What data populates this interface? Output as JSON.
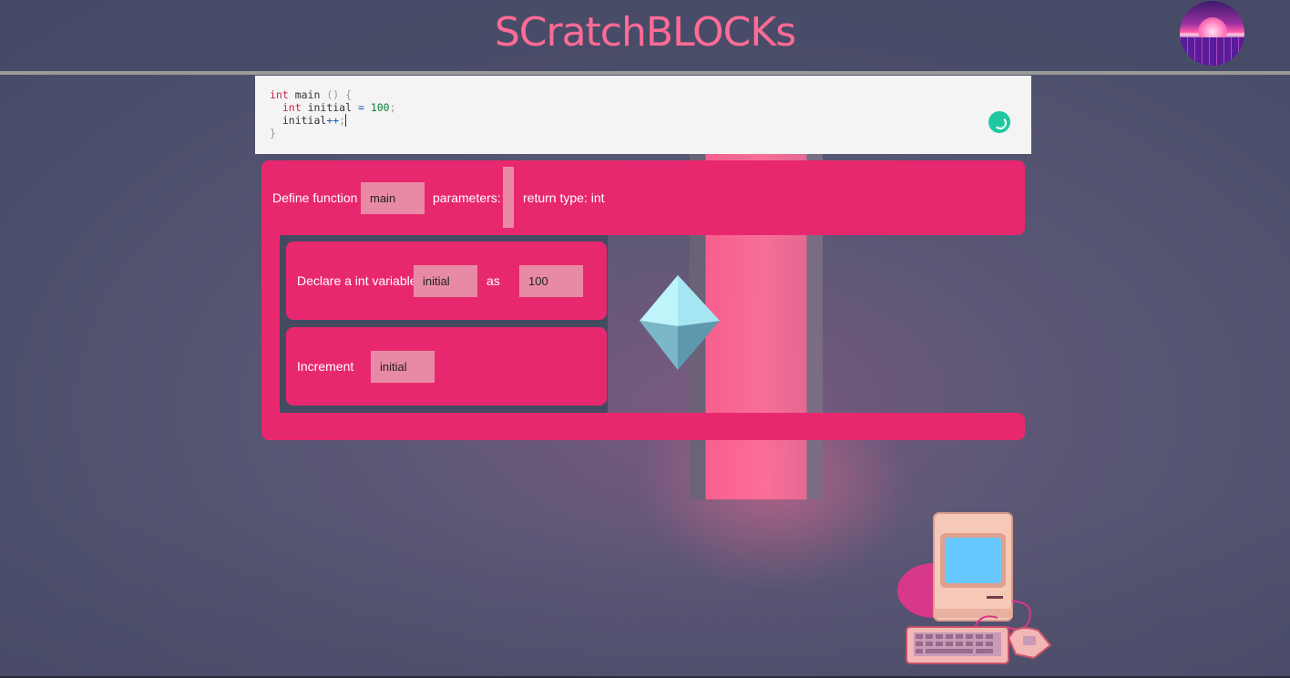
{
  "app": {
    "title": "SCratchBLOCKs"
  },
  "icons": {
    "avatar": "synthwave-sunset-avatar",
    "spinner": "loading-spinner-icon",
    "crystal": "crystal-decoration",
    "computer": "retro-computer-illustration"
  },
  "colors": {
    "accent": "#ff6b95",
    "block": "#e8286e",
    "slot": "#e88aa5",
    "spinner": "#1ec8a0"
  },
  "editor": {
    "lines": [
      "int main () {",
      "  int initial = 100;",
      "  initial++;",
      "}"
    ]
  },
  "blocks": {
    "function": {
      "define_label": "Define function",
      "name_value": "main",
      "parameters_label": "parameters:",
      "return_type_label": "return type: int"
    },
    "declare": {
      "label": "Declare a int variable",
      "name_value": "initial",
      "as_label": "as",
      "value": "100"
    },
    "increment": {
      "label": "Increment",
      "name_value": "initial"
    }
  }
}
